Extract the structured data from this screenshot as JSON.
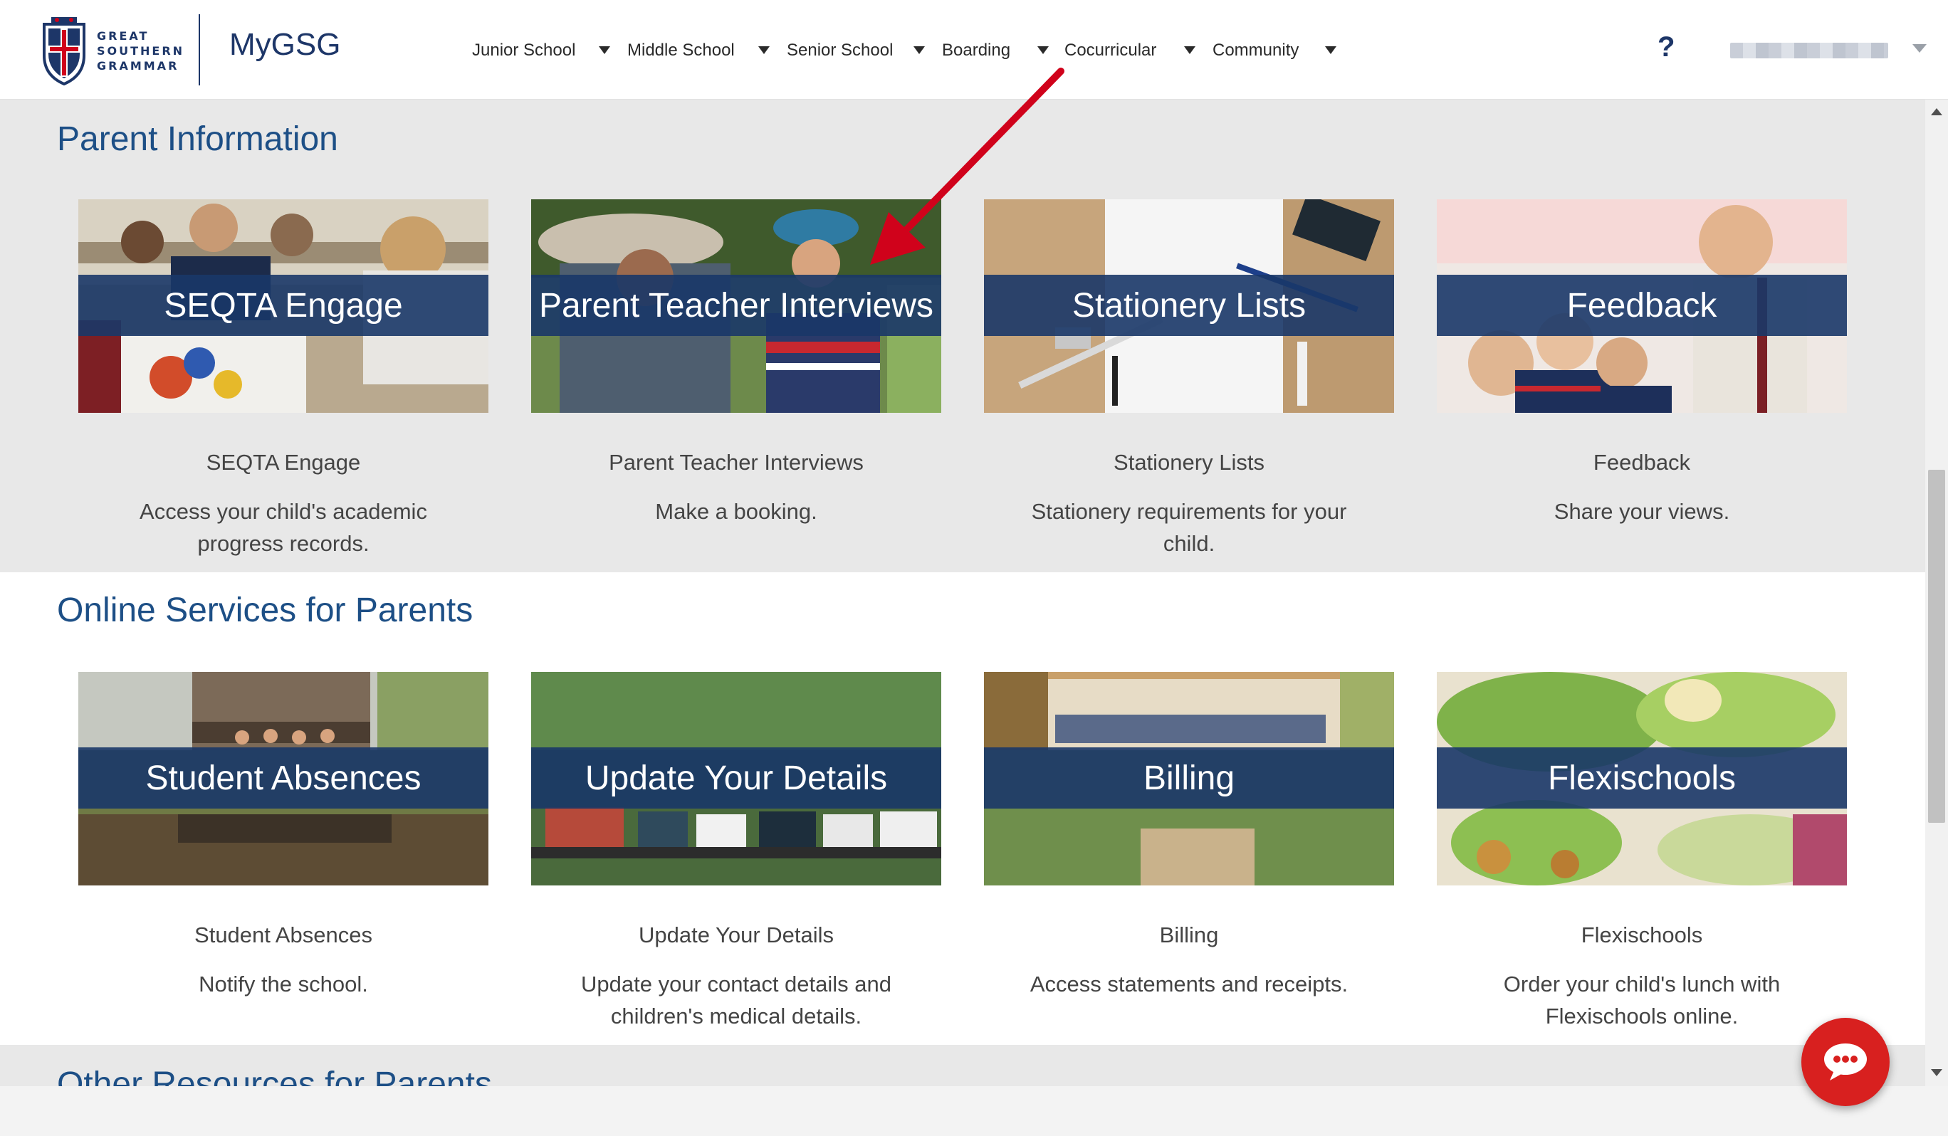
{
  "header": {
    "school_name": "GREAT SOUTHERN GRAMMAR",
    "brand_title": "MyGSG",
    "nav": [
      {
        "label": "Junior School"
      },
      {
        "label": "Middle School"
      },
      {
        "label": "Senior School"
      },
      {
        "label": "Boarding"
      },
      {
        "label": "Cocurricular"
      },
      {
        "label": "Community"
      }
    ],
    "help_label": "?",
    "icons": {
      "help": "help-icon",
      "user_menu": "chevron-down-icon",
      "nav_dropdown": "caret-down-icon"
    }
  },
  "sections": [
    {
      "title": "Parent Information",
      "cards": [
        {
          "banner": "SEQTA Engage",
          "name": "SEQTA Engage",
          "description": "Access your child's academic progress records."
        },
        {
          "banner": "Parent Teacher Interviews",
          "name": "Parent Teacher Interviews",
          "description": "Make a booking."
        },
        {
          "banner": "Stationery Lists",
          "name": "Stationery Lists",
          "description": "Stationery requirements for your child."
        },
        {
          "banner": "Feedback",
          "name": "Feedback",
          "description": "Share your views."
        }
      ]
    },
    {
      "title": "Online Services for Parents",
      "cards": [
        {
          "banner": "Student Absences",
          "name": "Student Absences",
          "description": "Notify the school."
        },
        {
          "banner": "Update Your Details",
          "name": "Update Your Details",
          "description": "Update your contact details and children's medical details."
        },
        {
          "banner": "Billing",
          "name": "Billing",
          "description": "Access statements and receipts."
        },
        {
          "banner": "Flexischools",
          "name": "Flexischools",
          "description": "Order your child's lunch with Flexischools online."
        }
      ]
    },
    {
      "title": "Other Resources for Parents"
    }
  ],
  "chat": {
    "icon": "chat-bubble-icon"
  },
  "colors": {
    "brand_navy": "#1d3668",
    "section_title": "#1d4f86",
    "banner": "#1a3768",
    "annotation_arrow": "#d0021b",
    "chat_button": "#d8201f"
  }
}
